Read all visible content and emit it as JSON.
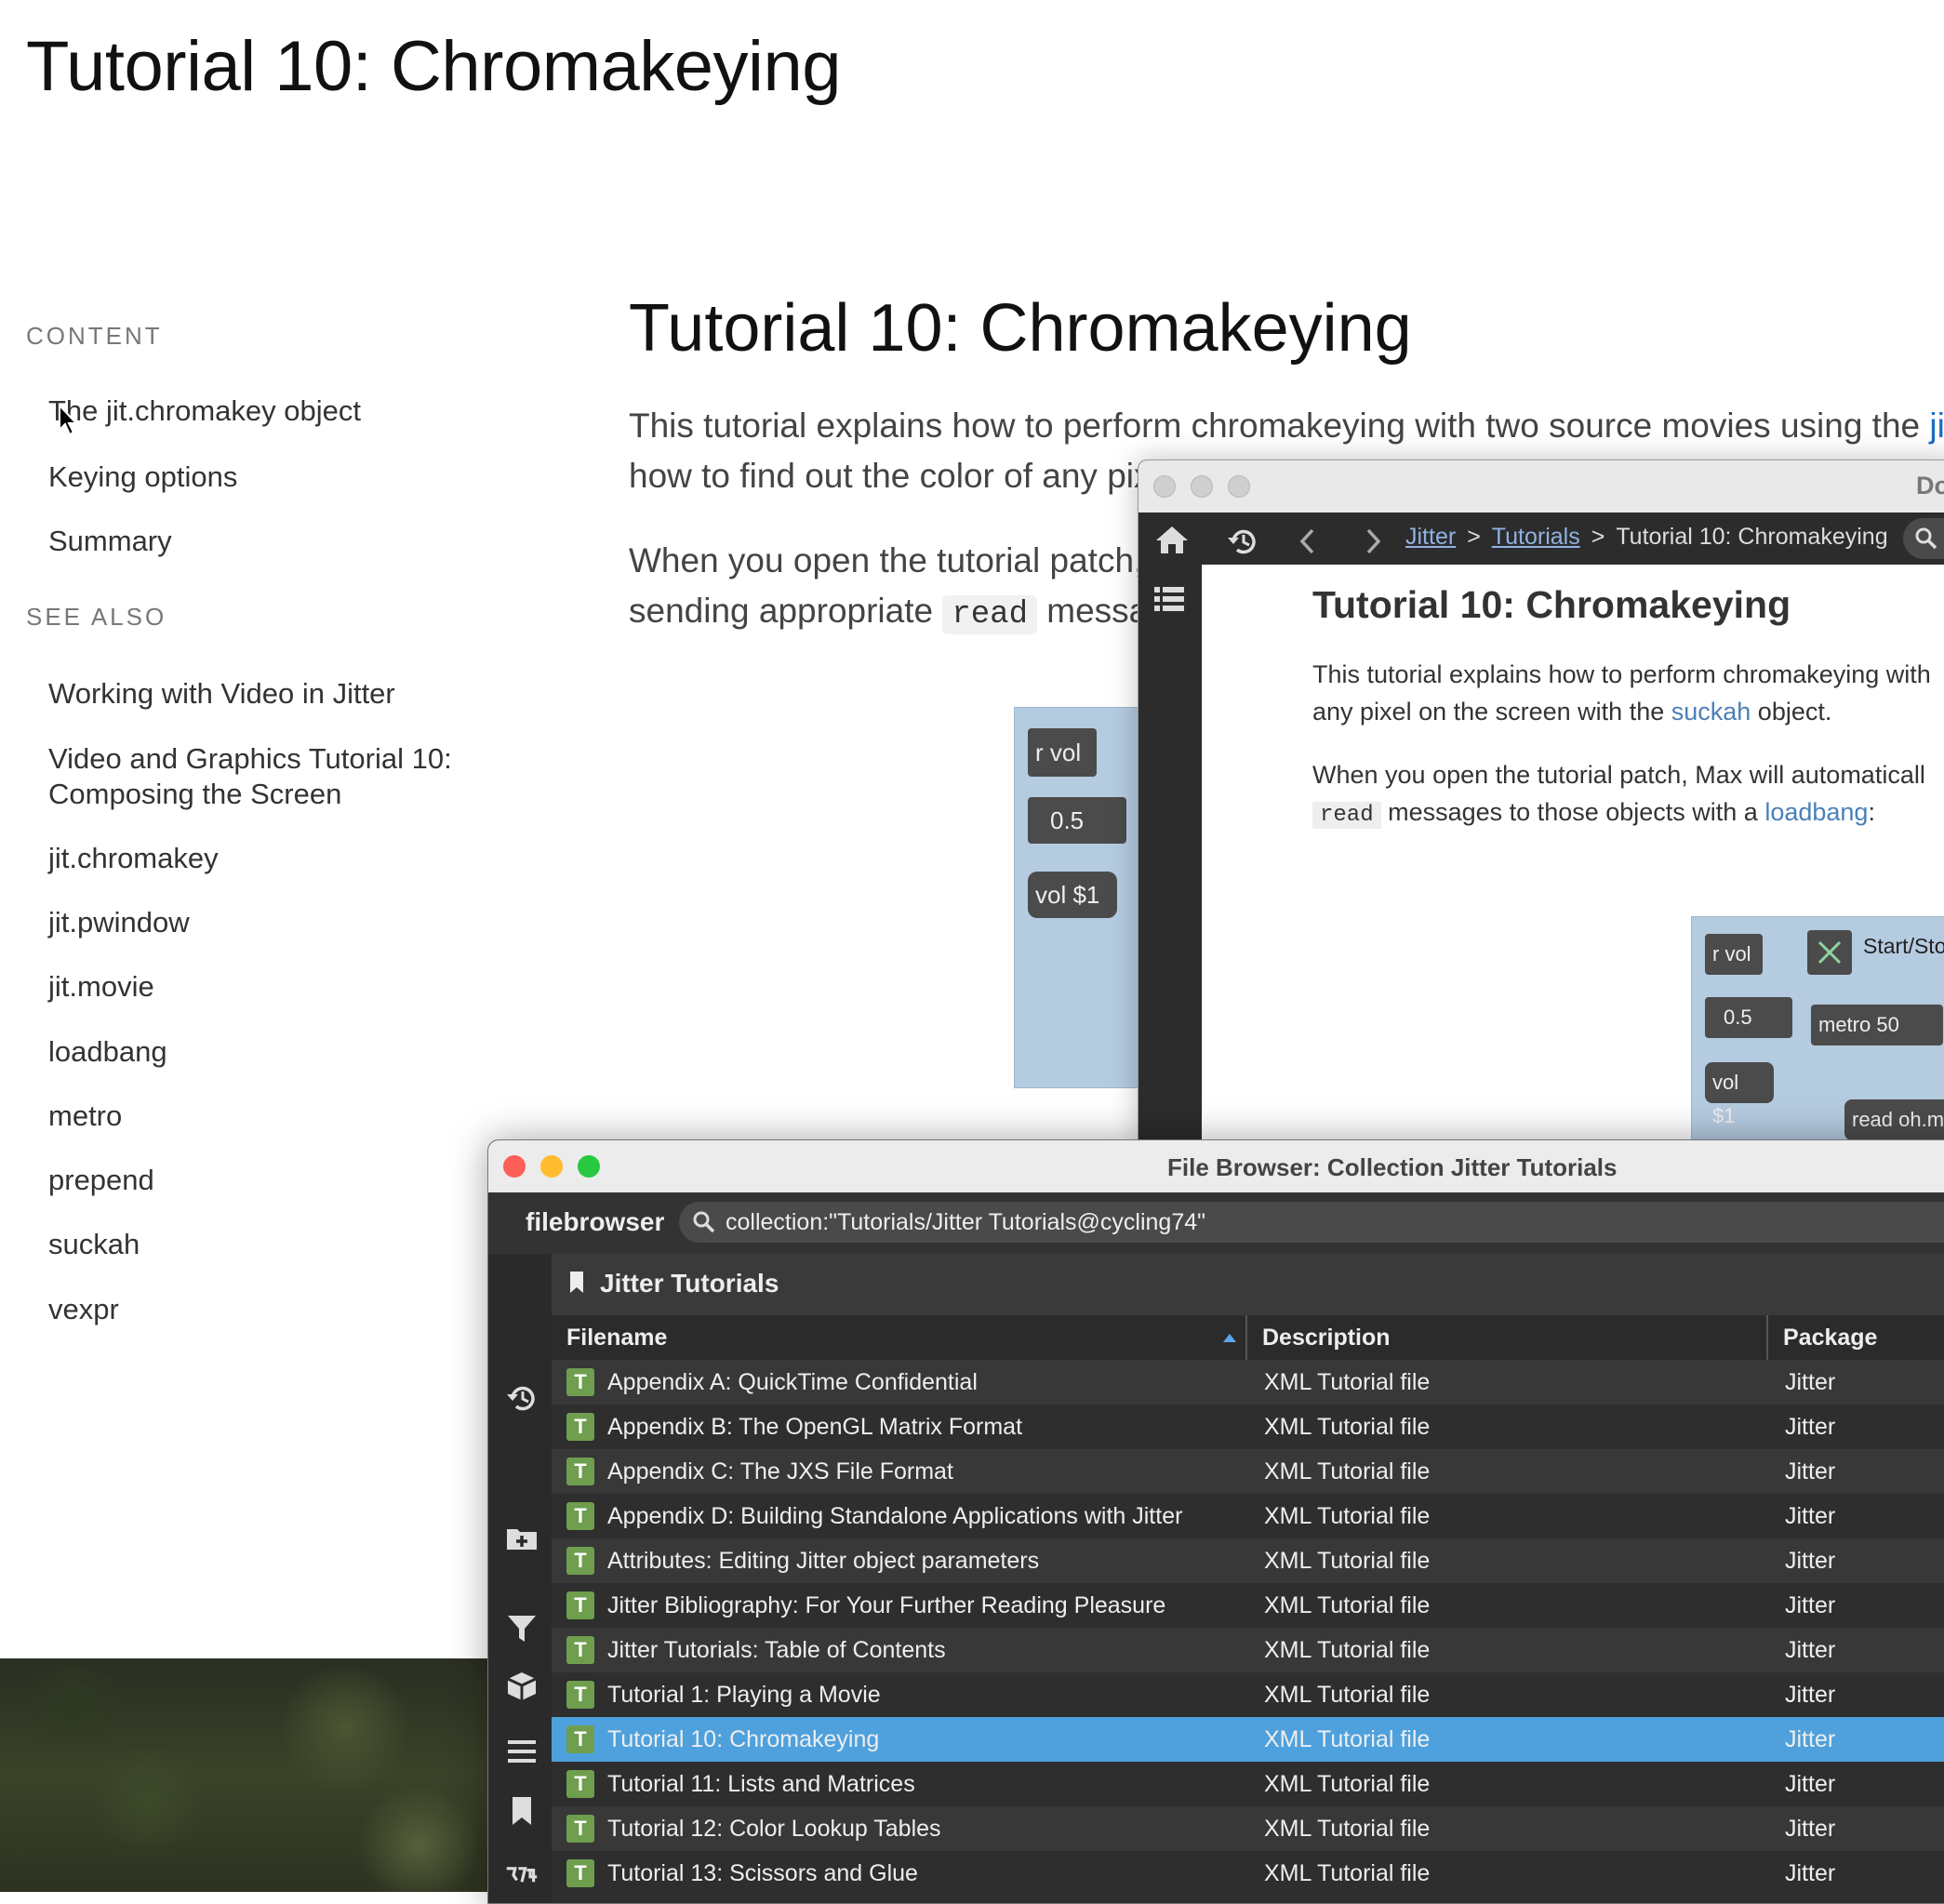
{
  "page": {
    "title": "Tutorial 10: Chromakeying"
  },
  "sidebar": {
    "content_heading": "CONTENT",
    "content_items": [
      "The jit.chromakey object",
      "Keying options",
      "Summary"
    ],
    "see_also_heading": "SEE ALSO",
    "see_also_items": [
      "Working with Video in Jitter",
      "Video and Graphics Tutorial 10:",
      "Composing the Screen",
      "jit.chromakey",
      "jit.pwindow",
      "jit.movie",
      "loadbang",
      "metro",
      "prepend",
      "suckah",
      "vexpr"
    ]
  },
  "main": {
    "heading": "Tutorial 10: Chromakeying",
    "p1_line1_text": "This tutorial explains how to perform chromakeying with two source movies using the ",
    "p1_line1_link": "jit.c",
    "p1_line2": "how to find out the color of any pix",
    "p2_line1": "When you open the tutorial patch,",
    "p2_line2_before": "sending appropriate ",
    "p2_line2_code": "read",
    "p2_line2_after": " messag"
  },
  "patch_bg": {
    "rvol": "r vol",
    "num": "0.5",
    "vol": "vol $1"
  },
  "doc_window": {
    "title": "Do",
    "breadcrumb": {
      "link1": "Jitter",
      "sep": ">",
      "link2": "Tutorials",
      "current": "Tutorial 10: Chromakeying"
    },
    "heading": "Tutorial 10: Chromakeying",
    "p1_line1": "This tutorial explains how to perform chromakeying with",
    "p1_line2_before": "any pixel on the screen with the ",
    "p1_line2_link": "suckah",
    "p1_line2_after": " object.",
    "p2_line1": "When you open the tutorial patch, Max will automaticall",
    "p2_line2_code": "read",
    "p2_line2_mid": " messages to those objects with a ",
    "p2_line2_link": "loadbang",
    "p2_line2_after": ":",
    "patch": {
      "rvol": "r vol",
      "num": "0.5",
      "vol": "vol $1",
      "toggle_label": "Start/Sto",
      "metro": "metro 50",
      "read": "read oh.m"
    }
  },
  "file_browser": {
    "title": "File Browser: Collection Jitter Tutorials",
    "brand": "filebrowser",
    "search_value": "collection:\"Tutorials/Jitter Tutorials@cycling74\"",
    "collection_title": "Jitter Tutorials",
    "columns": {
      "filename": "Filename",
      "description": "Description",
      "package": "Package"
    },
    "badge": "T",
    "rows": [
      {
        "filename": "Appendix A: QuickTime Confidential",
        "description": "XML Tutorial file",
        "package": "Jitter"
      },
      {
        "filename": "Appendix B: The OpenGL Matrix Format",
        "description": "XML Tutorial file",
        "package": "Jitter"
      },
      {
        "filename": "Appendix C: The JXS File Format",
        "description": "XML Tutorial file",
        "package": "Jitter"
      },
      {
        "filename": "Appendix D: Building Standalone Applications with Jitter",
        "description": "XML Tutorial file",
        "package": "Jitter"
      },
      {
        "filename": "Attributes: Editing Jitter object parameters",
        "description": "XML Tutorial file",
        "package": "Jitter"
      },
      {
        "filename": "Jitter Bibliography: For Your Further Reading Pleasure",
        "description": "XML Tutorial file",
        "package": "Jitter"
      },
      {
        "filename": "Jitter Tutorials: Table of Contents",
        "description": "XML Tutorial file",
        "package": "Jitter"
      },
      {
        "filename": "Tutorial 1: Playing a Movie",
        "description": "XML Tutorial file",
        "package": "Jitter"
      },
      {
        "filename": "Tutorial 10: Chromakeying",
        "description": "XML Tutorial file",
        "package": "Jitter"
      },
      {
        "filename": "Tutorial 11: Lists and Matrices",
        "description": "XML Tutorial file",
        "package": "Jitter"
      },
      {
        "filename": "Tutorial 12: Color Lookup Tables",
        "description": "XML Tutorial file",
        "package": "Jitter"
      },
      {
        "filename": "Tutorial 13: Scissors and Glue",
        "description": "XML Tutorial file",
        "package": "Jitter"
      }
    ],
    "selected_row": 8
  },
  "colors": {
    "selection": "#4ea1dc",
    "link": "#1a6fc2",
    "badge": "#6e9e4e",
    "close": "#fe5f57",
    "minimize": "#febc2e",
    "zoom": "#28c840"
  },
  "icons": {
    "doc_nav": [
      "home-icon",
      "history-icon",
      "back-icon",
      "forward-icon",
      "search-icon",
      "list-icon"
    ],
    "fb_sidebar": [
      "history-icon",
      "add-folder-icon",
      "filter-icon",
      "package-icon",
      "menu-icon",
      "bookmark-icon",
      "cycling74-logo-icon"
    ]
  }
}
